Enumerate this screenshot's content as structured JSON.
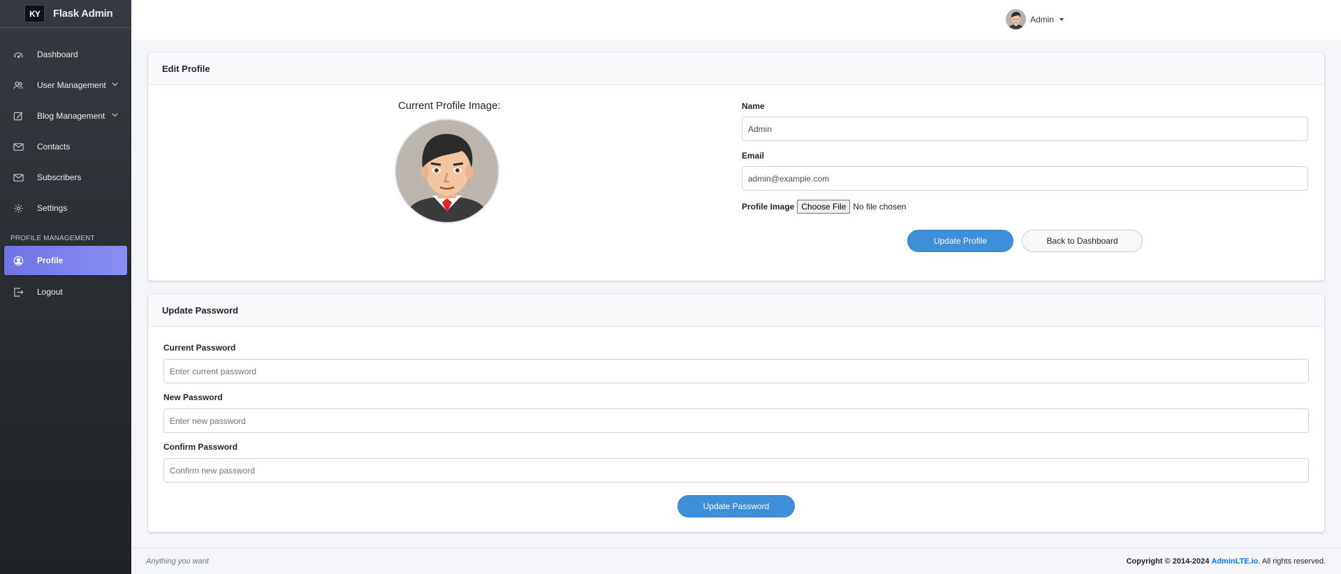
{
  "brand": {
    "logo": "KY",
    "name": "Flask Admin"
  },
  "sidebar": {
    "items": [
      {
        "label": "Dashboard",
        "icon": "gauge-icon"
      },
      {
        "label": "User Management",
        "icon": "users-icon"
      },
      {
        "label": "Blog Management",
        "icon": "edit-icon"
      },
      {
        "label": "Contacts",
        "icon": "envelope-icon"
      },
      {
        "label": "Subscribers",
        "icon": "envelope-icon"
      },
      {
        "label": "Settings",
        "icon": "gear-icon"
      }
    ],
    "section_header": "PROFILE MANAGEMENT",
    "profile_label": "Profile",
    "logout_label": "Logout"
  },
  "topbar": {
    "user_name": "Admin"
  },
  "edit_profile": {
    "title": "Edit Profile",
    "image_title": "Current Profile Image:",
    "name_label": "Name",
    "name_value": "Admin",
    "email_label": "Email",
    "email_value": "admin@example.com",
    "image_label": "Profile Image",
    "choose_file": "Choose File",
    "no_file": "No file chosen",
    "update_button": "Update Profile",
    "back_button": "Back to Dashboard"
  },
  "update_password": {
    "title": "Update Password",
    "current_label": "Current Password",
    "current_placeholder": "Enter current password",
    "new_label": "New Password",
    "new_placeholder": "Enter new password",
    "confirm_label": "Confirm Password",
    "confirm_placeholder": "Confirm new password",
    "submit_button": "Update Password"
  },
  "footer": {
    "left": "Anything you want",
    "copyright": "Copyright © 2014-2024",
    "link": "AdminLTE.io",
    "rights": ". All rights reserved."
  },
  "colors": {
    "accent": "#3d8fd8",
    "active_nav": "#7c80ec",
    "sidebar_bg": "#343a40"
  }
}
